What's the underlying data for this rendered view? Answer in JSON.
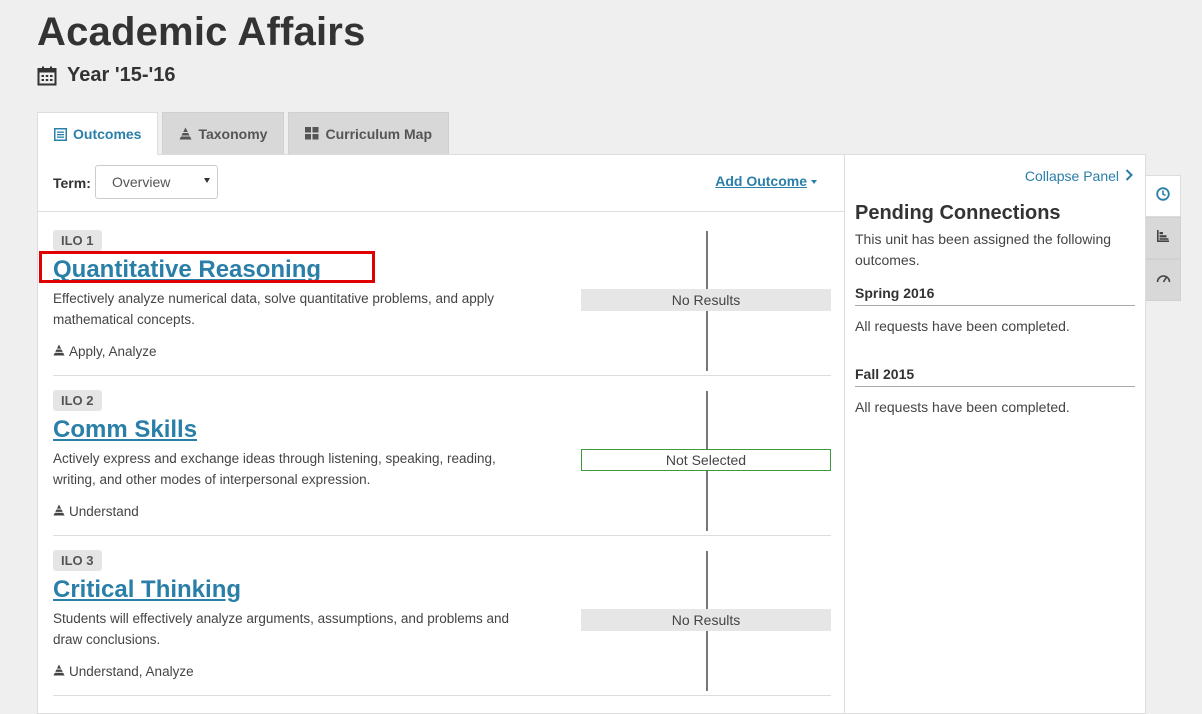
{
  "page": {
    "title": "Academic Affairs",
    "year": "Year '15-'16",
    "icons": {
      "year": "calendar-icon"
    }
  },
  "tabs": [
    {
      "label": "Outcomes",
      "icon": "list-icon",
      "active": true
    },
    {
      "label": "Taxonomy",
      "icon": "pyramid-icon",
      "active": false
    },
    {
      "label": "Curriculum Map",
      "icon": "grid-icon",
      "active": false
    }
  ],
  "toolbar": {
    "term_label": "Term:",
    "term_value": "Overview",
    "add_outcome_label": "Add Outcome"
  },
  "outcomes": [
    {
      "badge": "ILO 1",
      "title": "Quantitative Reasoning",
      "description": "Effectively analyze numerical data, solve quantitative problems, and apply mathematical concepts.",
      "taxonomy": "Apply, Analyze",
      "status": "No Results"
    },
    {
      "badge": "ILO 2",
      "title": "Comm Skills",
      "description": "Actively express and exchange ideas through listening, speaking, reading, writing, and other modes of interpersonal expression.",
      "taxonomy": "Understand",
      "status": "Not Selected"
    },
    {
      "badge": "ILO 3",
      "title": "Critical Thinking",
      "description": "Students will effectively analyze arguments, assumptions, and problems and draw conclusions.",
      "taxonomy": "Understand, Analyze",
      "status": "No Results"
    }
  ],
  "side_panel": {
    "collapse_label": "Collapse Panel",
    "title": "Pending Connections",
    "description": "This unit has been assigned the following outcomes.",
    "terms": [
      {
        "name": "Spring 2016",
        "message": "All requests have been completed."
      },
      {
        "name": "Fall 2015",
        "message": "All requests have been completed."
      }
    ],
    "tab_icons": [
      "clock-icon",
      "bar-chart-icon",
      "gauge-icon"
    ]
  },
  "colors": {
    "accent": "#2a7fa8",
    "highlight": "#e00000",
    "status_border": "#3c9a3c",
    "background": "#efefef"
  }
}
